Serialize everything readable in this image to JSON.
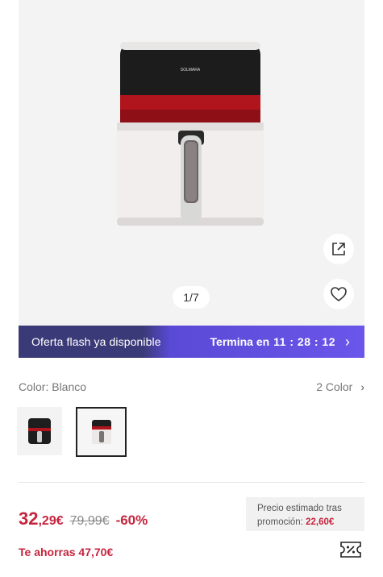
{
  "gallery": {
    "pager": "1/7",
    "brand_on_device": "SOLMARA",
    "icons": [
      "share-icon",
      "heart-icon"
    ]
  },
  "flash": {
    "label": "Oferta flash ya disponible",
    "ends_label": "Termina en",
    "timer": "11 : 28 : 12",
    "chevron": "›"
  },
  "color": {
    "label": "Color: Blanco",
    "count": "2 Color",
    "chevron": "›",
    "options": [
      "black-airfryer",
      "white-airfryer"
    ],
    "selected": "white-airfryer"
  },
  "price": {
    "main": "32",
    "cents": ",29€",
    "old": "79,99€",
    "discount": "-60%",
    "promo_line1": "Precio estimado tras",
    "promo_line2": "promoción:",
    "promo_value": "22,60€",
    "savings": "Te ahorras 47,70€"
  },
  "colors": {
    "accent": "#c6243d",
    "flash_dark": "#3b3a78",
    "flash_light": "#6a56ea"
  }
}
